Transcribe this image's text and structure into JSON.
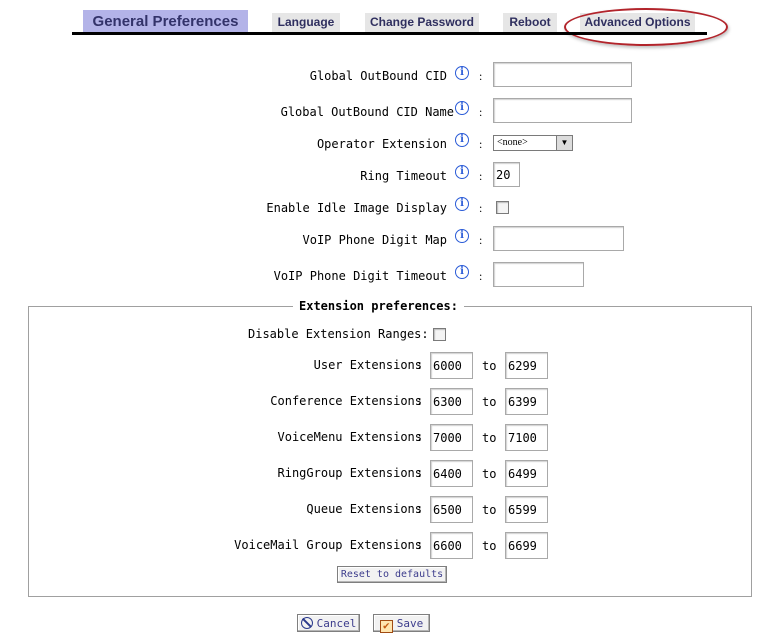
{
  "tabs": {
    "general": "General Preferences",
    "language": "Language",
    "change_password": "Change Password",
    "reboot": "Reboot",
    "advanced": "Advanced Options"
  },
  "fields": {
    "global_cid": {
      "label": "Global OutBound CID",
      "value": ""
    },
    "global_cid_name": {
      "label": "Global OutBound CID Name",
      "value": ""
    },
    "operator_ext": {
      "label": "Operator Extension",
      "value": "<none>"
    },
    "ring_timeout": {
      "label": "Ring Timeout",
      "value": "20"
    },
    "idle_image": {
      "label": "Enable Idle Image Display",
      "checked": false
    },
    "digit_map": {
      "label": "VoIP Phone Digit Map",
      "value": ""
    },
    "digit_timeout": {
      "label": "VoIP Phone Digit Timeout",
      "value": ""
    }
  },
  "extension_prefs": {
    "legend": "Extension preferences:",
    "disable_ranges_label": "Disable Extension Ranges:",
    "to_label": "to",
    "ranges": [
      {
        "label": "User Extensions",
        "from": "6000",
        "to": "6299"
      },
      {
        "label": "Conference Extensions",
        "from": "6300",
        "to": "6399"
      },
      {
        "label": "VoiceMenu Extensions",
        "from": "7000",
        "to": "7100"
      },
      {
        "label": "RingGroup Extensions",
        "from": "6400",
        "to": "6499"
      },
      {
        "label": "Queue Extensions",
        "from": "6500",
        "to": "6599"
      },
      {
        "label": "VoiceMail Group Extensions",
        "from": "6600",
        "to": "6699"
      }
    ],
    "reset_label": "Reset to defaults"
  },
  "buttons": {
    "cancel": "Cancel",
    "save": "Save"
  },
  "colon": ":",
  "info_glyph": "i"
}
